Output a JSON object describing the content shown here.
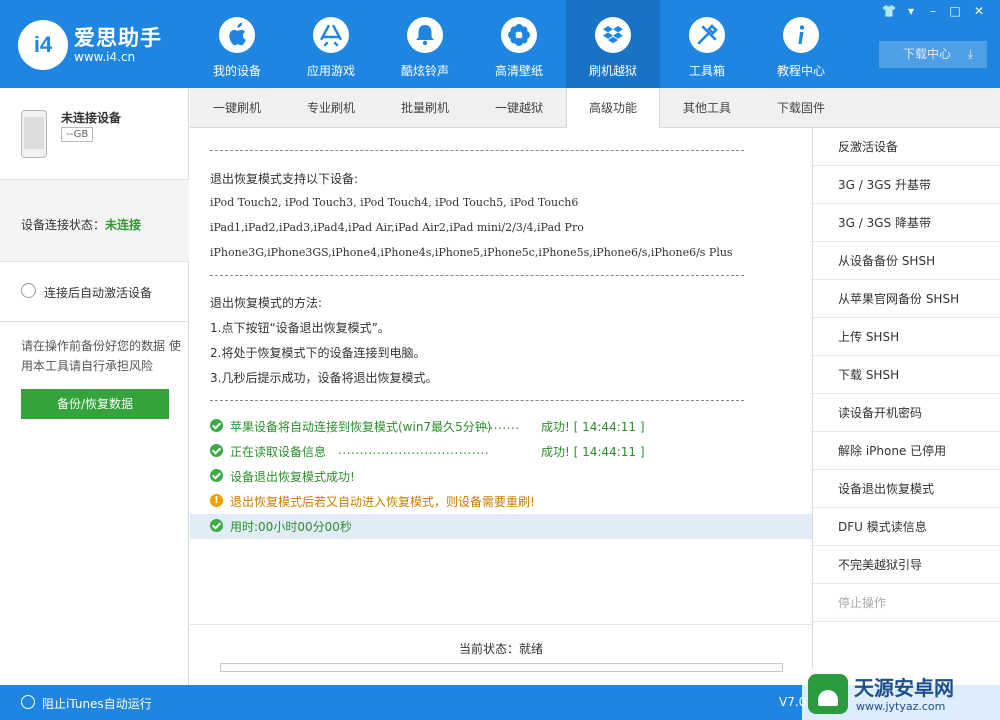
{
  "brand": {
    "badge": "i4",
    "name": "爱思助手",
    "url": "www.i4.cn"
  },
  "nav": [
    {
      "label": "我的设备",
      "icon": "apple-icon"
    },
    {
      "label": "应用游戏",
      "icon": "app-store-icon"
    },
    {
      "label": "酷炫铃声",
      "icon": "bell-icon"
    },
    {
      "label": "高清壁纸",
      "icon": "flower-icon"
    },
    {
      "label": "刷机越狱",
      "icon": "dropbox-icon"
    },
    {
      "label": "工具箱",
      "icon": "tools-icon"
    },
    {
      "label": "教程中心",
      "icon": "info-icon"
    }
  ],
  "nav_active": "刷机越狱",
  "window_controls": {
    "skin": "👕",
    "menu": "▾",
    "minimize": "–",
    "maximize": "□",
    "close": "✕"
  },
  "download_center": {
    "label": "下载中心",
    "arrow": "⤓"
  },
  "tabs": [
    "一键刷机",
    "专业刷机",
    "批量刷机",
    "一键越狱",
    "高级功能",
    "其他工具",
    "下载固件"
  ],
  "tab_active": "高级功能",
  "device": {
    "name": "未连接设备",
    "capacity": "--GB"
  },
  "connection": {
    "label": "设备连接状态：",
    "value": "未连接"
  },
  "auto_activate": {
    "label": "连接后自动激活设备"
  },
  "backup_warning": "请在操作前备份好您的数据 使用本工具请自行承担风险",
  "backup_button": "备份/恢复数据",
  "log": {
    "supported_title": "退出恢复模式支持以下设备:",
    "supported_ipod": "iPod Touch2, iPod Touch3, iPod Touch4, iPod Touch5, iPod Touch6",
    "supported_ipad": "iPad1,iPad2,iPad3,iPad4,iPad Air,iPad Air2,iPad mini/2/3/4,iPad Pro",
    "supported_iphone": "iPhone3G,iPhone3GS,iPhone4,iPhone4s,iPhone5,iPhone5c,iPhone5s,iPhone6/s,iPhone6/s Plus",
    "method_title": "退出恢复模式的方法:",
    "step1": "1.点下按钮“设备退出恢复模式”。",
    "step2": "2.将处于恢复模式下的设备连接到电脑。",
    "step3": "3.几秒后提示成功，设备将退出恢复模式。",
    "status": [
      {
        "type": "ok",
        "text": "苹果设备将自动连接到恢复模式(win7最久5分钟)",
        "dots": "........",
        "result": "成功! [ 14:44:11 ]"
      },
      {
        "type": "ok",
        "text": "正在读取设备信息",
        "dots": "...................................",
        "result": "成功! [ 14:44:11 ]"
      },
      {
        "type": "ok",
        "text": "设备退出恢复模式成功!",
        "dots": "",
        "result": ""
      },
      {
        "type": "warn",
        "text": "退出恢复模式后若又自动进入恢复模式，则设备需要重刷!",
        "dots": "",
        "result": ""
      },
      {
        "type": "ok",
        "text": "用时:00小时00分00秒",
        "dots": "",
        "result": ""
      }
    ]
  },
  "current_status": {
    "label": "当前状态：就绪",
    "progress": 0
  },
  "right_menu": [
    {
      "label": "反激活设备",
      "enabled": true
    },
    {
      "label": "3G / 3GS 升基带",
      "enabled": true
    },
    {
      "label": "3G / 3GS 降基带",
      "enabled": true
    },
    {
      "label": "从设备备份 SHSH",
      "enabled": true
    },
    {
      "label": "从苹果官网备份 SHSH",
      "enabled": true
    },
    {
      "label": "上传 SHSH",
      "enabled": true
    },
    {
      "label": "下载 SHSH",
      "enabled": true
    },
    {
      "label": "读设备开机密码",
      "enabled": true
    },
    {
      "label": "解除 iPhone 已停用",
      "enabled": true
    },
    {
      "label": "设备退出恢复模式",
      "enabled": true
    },
    {
      "label": "DFU 模式读信息",
      "enabled": true
    },
    {
      "label": "不完美越狱引导",
      "enabled": true
    },
    {
      "label": "停止操作",
      "enabled": false
    }
  ],
  "footer": {
    "itunes_label": "阻止iTunes自动运行",
    "version": "V7.0"
  },
  "watermark": {
    "name": "天源安卓网",
    "url": "www.jytyaz.com"
  },
  "colors": {
    "brand_blue": "#1e86e0",
    "success_green": "#2c8f2c",
    "warning_orange": "#c97e00",
    "button_green": "#34a33c"
  }
}
